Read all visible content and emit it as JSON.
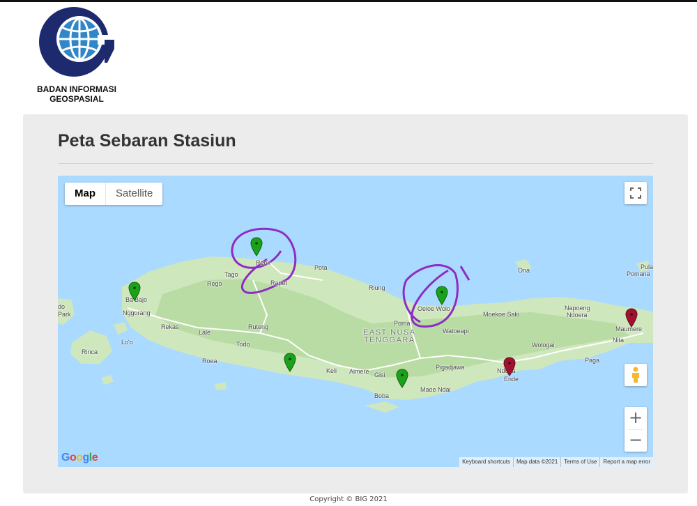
{
  "header": {
    "org_name_line1": "BADAN INFORMASI",
    "org_name_line2": "GEOSPASIAL",
    "logo_icon": "globe-logo-icon",
    "colors": {
      "logo_navy": "#1e2a6e",
      "logo_blue": "#2f86c8"
    }
  },
  "panel": {
    "title": "Peta Sebaran Stasiun"
  },
  "map": {
    "map_type_buttons": [
      "Map",
      "Satellite"
    ],
    "active_map_type": "Map",
    "zoom_in_label": "+",
    "zoom_out_label": "−",
    "provider_logo": "Google",
    "attribution": [
      "Keyboard shortcuts",
      "Map data ©2021",
      "Terms of Use",
      "Report a map error"
    ],
    "colors": {
      "water": "#aadaff",
      "land": "#d4ebc6",
      "land_dark": "#b8dca5",
      "road": "#ffffff",
      "pin_green": "#1aa31a",
      "pin_red": "#a0122d",
      "annotation": "#8e2cc4"
    },
    "place_labels": {
      "reok": "Reok",
      "pota": "Pota",
      "tago": "Tago",
      "rego": "Rego",
      "rapet": "Rapet",
      "labuan_bajo": "Bajo",
      "bajo_b": "Ba",
      "nggorang": "Nggorang",
      "komodo_park": "Park",
      "komodo_do": "do",
      "rekas": "Rekas",
      "lale": "Lale",
      "ruteng": "Ruteng",
      "todo": "Todo",
      "loo": "Lo'o",
      "rinca": "Rinca",
      "roea": "Roea",
      "keli": "Keli",
      "aimere": "Aimere",
      "gisi": "Gisi",
      "boba": "Boba",
      "maoe_ndai": "Maoe Ndai",
      "pigadjawa": "Pigadjawa",
      "riung": "Riung",
      "oeloe_wolo": "Oeloe Wolo",
      "poma": "Poma",
      "watoeapi": "Watoeapi",
      "moekoe_saki": "Moekoe Saki",
      "napoeng": "Napoeng",
      "ndoera": "Ndoera",
      "ona": "Ona",
      "pula": "Pula",
      "pomana": "Pomana",
      "maumere": "Maumere",
      "nita": "Nita",
      "wologai": "Wologai",
      "paga": "Paga",
      "ndona": "Ndona",
      "ende": "Ende",
      "region_line1": "EAST NUSA",
      "region_line2": "TENGGARA"
    },
    "stations": [
      {
        "name": "reok-station-pin",
        "status": "green"
      },
      {
        "name": "labuan-bajo-station-pin",
        "status": "green"
      },
      {
        "name": "roea-coast-station-pin",
        "status": "green"
      },
      {
        "name": "aimere-station-pin",
        "status": "green"
      },
      {
        "name": "riung-station-pin",
        "status": "green"
      },
      {
        "name": "ende-station-pin",
        "status": "red"
      },
      {
        "name": "maumere-station-pin",
        "status": "red"
      }
    ]
  },
  "footer": {
    "copyright": "Copyright © BIG 2021"
  }
}
